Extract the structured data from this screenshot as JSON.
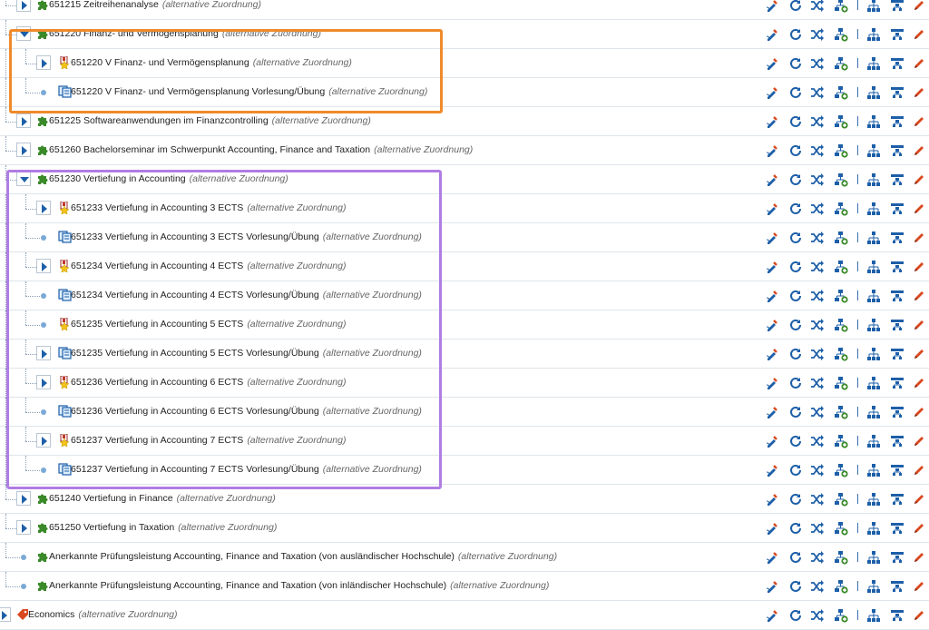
{
  "alt_label": "(alternative Zuordnung)",
  "rows": [
    {
      "label": "651215 Zeitreihenanalyse",
      "icon": "puzzle-icon",
      "toggle": "collapsed",
      "level": 0
    },
    {
      "label": "651220 Finanz- und Vermögensplanung",
      "icon": "puzzle-icon",
      "toggle": "expanded",
      "level": 0
    },
    {
      "label": "651220 V Finanz- und Vermögensplanung",
      "icon": "exam-icon",
      "toggle": "collapsed",
      "level": 1
    },
    {
      "label": "651220 V Finanz- und Vermögensplanung Vorlesung/Übung",
      "icon": "course-icon",
      "toggle": "leaf",
      "level": 1
    },
    {
      "label": "651225 Softwareanwendungen im Finanzcontrolling",
      "icon": "puzzle-icon",
      "toggle": "collapsed",
      "level": 0
    },
    {
      "label": "651260 Bachelorseminar im Schwerpunkt Accounting, Finance and Taxation",
      "icon": "puzzle-icon",
      "toggle": "collapsed",
      "level": 0
    },
    {
      "label": "651230 Vertiefung in Accounting",
      "icon": "puzzle-icon",
      "toggle": "expanded",
      "level": 0
    },
    {
      "label": "651233 Vertiefung in Accounting 3 ECTS",
      "icon": "exam-icon",
      "toggle": "collapsed",
      "level": 1
    },
    {
      "label": "651233 Vertiefung in Accounting 3 ECTS Vorlesung/Übung",
      "icon": "course-icon",
      "toggle": "leaf",
      "level": 1
    },
    {
      "label": "651234 Vertiefung in Accounting 4 ECTS",
      "icon": "exam-icon",
      "toggle": "collapsed",
      "level": 1
    },
    {
      "label": "651234 Vertiefung in Accounting 4 ECTS Vorlesung/Übung",
      "icon": "course-icon",
      "toggle": "leaf",
      "level": 1
    },
    {
      "label": "651235 Vertiefung in Accounting 5 ECTS",
      "icon": "exam-icon",
      "toggle": "leaf",
      "level": 1
    },
    {
      "label": "651235 Vertiefung in Accounting 5 ECTS Vorlesung/Übung",
      "icon": "course-icon",
      "toggle": "collapsed",
      "level": 1
    },
    {
      "label": "651236 Vertiefung in Accounting 6 ECTS",
      "icon": "exam-icon",
      "toggle": "collapsed",
      "level": 1
    },
    {
      "label": "651236 Vertiefung in Accounting 6 ECTS Vorlesung/Übung",
      "icon": "course-icon",
      "toggle": "leaf",
      "level": 1
    },
    {
      "label": "651237 Vertiefung in Accounting 7 ECTS",
      "icon": "exam-icon",
      "toggle": "collapsed",
      "level": 1
    },
    {
      "label": "651237 Vertiefung in Accounting 7 ECTS Vorlesung/Übung",
      "icon": "course-icon",
      "toggle": "leaf",
      "level": 1
    },
    {
      "label": "651240 Vertiefung in Finance",
      "icon": "puzzle-icon",
      "toggle": "collapsed",
      "level": 0
    },
    {
      "label": "651250 Vertiefung in Taxation",
      "icon": "puzzle-icon",
      "toggle": "collapsed",
      "level": 0
    },
    {
      "label": "Anerkannte Prüfungsleistung Accounting, Finance and Taxation (von ausländischer Hochschule)",
      "icon": "puzzle-icon",
      "toggle": "leaf",
      "level": 0
    },
    {
      "label": "Anerkannte Prüfungsleistung Accounting, Finance and Taxation (von inländischer Hochschule)",
      "icon": "puzzle-icon",
      "toggle": "leaf",
      "level": 0
    },
    {
      "label": "Economics",
      "icon": "tag-icon",
      "toggle": "collapsed",
      "level": -1
    }
  ],
  "actions": [
    "inspect-icon",
    "refresh-icon",
    "shuffle-icon",
    "add-node-icon",
    "tree-structure-icon",
    "filter-tree-icon",
    "edit-pencil-icon"
  ],
  "colors": {
    "accent_blue": "#1d5fa8",
    "puzzle_green": "#3a8a2a",
    "edit_red": "#d9481e",
    "highlight_orange": "#ef8a2b",
    "highlight_purple": "#b07de3"
  }
}
